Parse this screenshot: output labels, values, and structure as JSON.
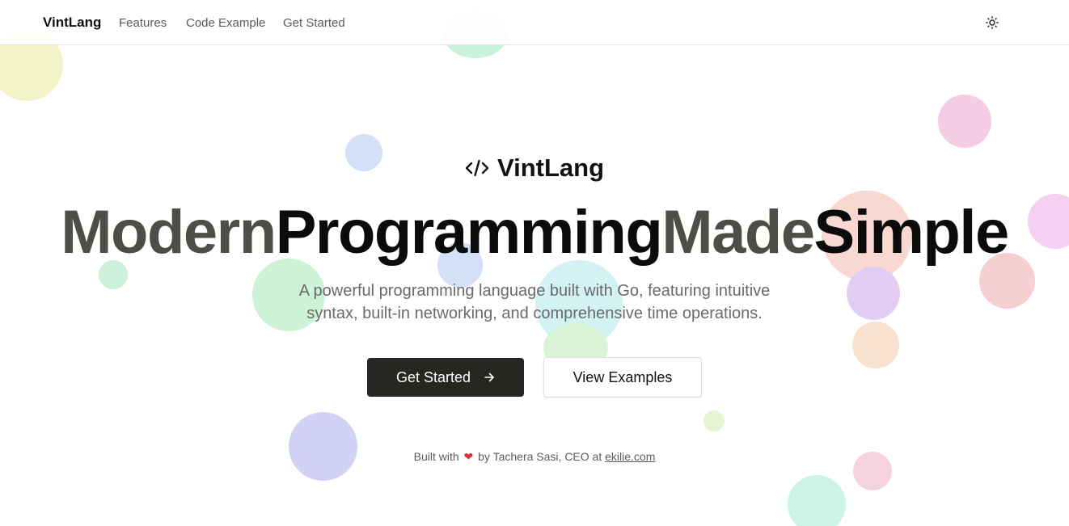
{
  "nav": {
    "brand": "VintLang",
    "links": [
      "Features",
      "Code Example",
      "Get Started"
    ],
    "theme_toggle_icon": "sun-icon"
  },
  "hero": {
    "logo_icon": "code-icon",
    "logo_text": "VintLang",
    "headline_words": [
      "Modern",
      "Programming",
      "Made",
      "Simple"
    ],
    "subtitle": "A powerful programming language built with Go, featuring intuitive syntax, built-in networking, and comprehensive time operations.",
    "primary_button": "Get Started",
    "primary_button_icon": "arrow-right-icon",
    "secondary_button": "View Examples"
  },
  "footer": {
    "prefix": "Built with",
    "heart_icon": "heart-icon",
    "middle": "by Tachera Sasi, CEO at",
    "link": "ekilie.com"
  },
  "colors": {
    "primary_button_bg": "#262623",
    "headline_muted": "#4e4e49",
    "headline_dark": "#0b0b0b",
    "heart": "#e0303a"
  }
}
